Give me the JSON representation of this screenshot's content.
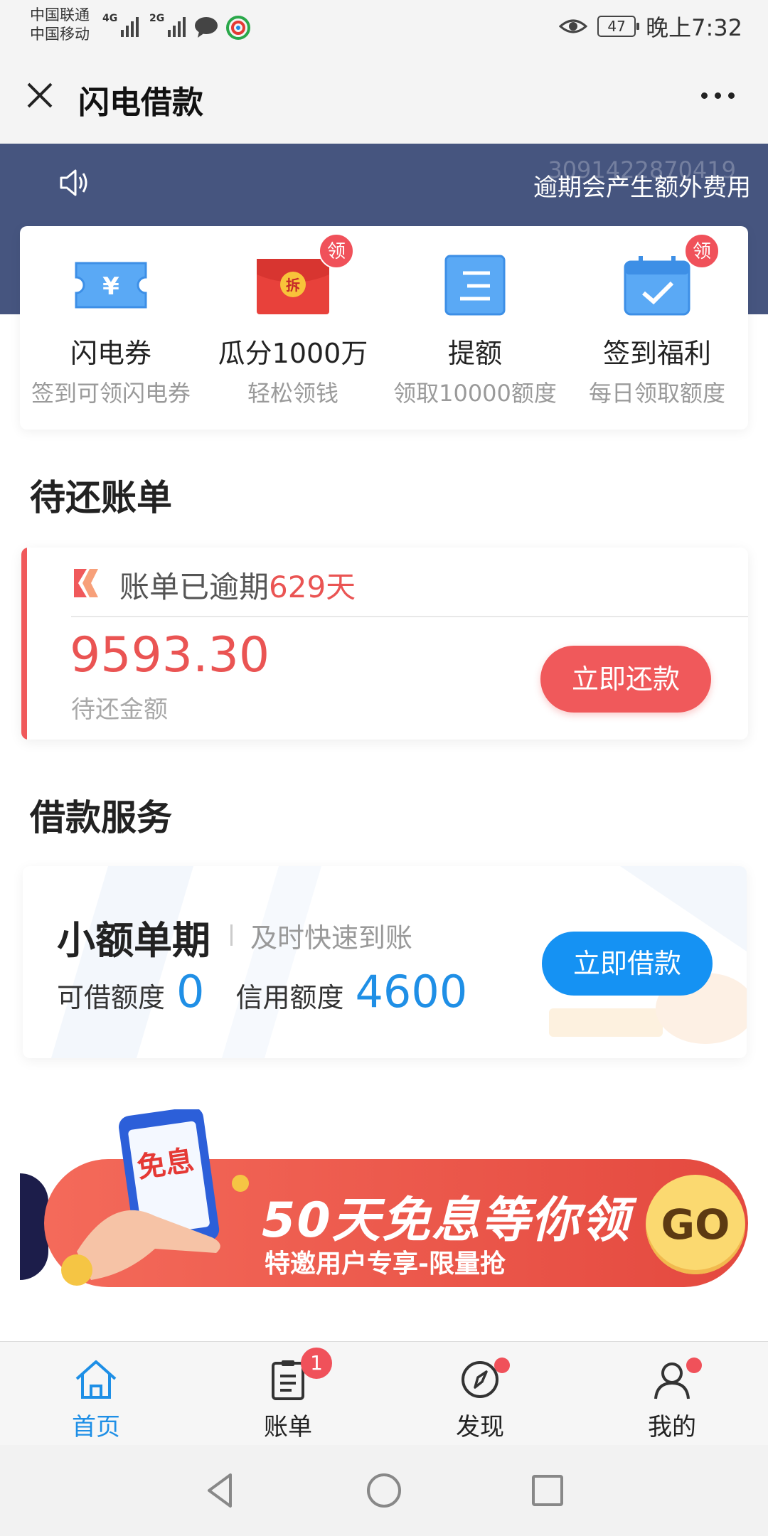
{
  "status_bar": {
    "carrier1": "中国联通",
    "carrier2": "中国移动",
    "net1": "4G",
    "net2": "2G",
    "battery": "47",
    "time": "晚上7:32"
  },
  "title_bar": {
    "title": "闪电借款"
  },
  "notice": {
    "faded_id": "3091422870419",
    "text": "逾期会产生额外费用"
  },
  "quick_entries": [
    {
      "title": "闪电券",
      "subtitle": "签到可领闪电券",
      "icon": "ticket-icon",
      "badge": ""
    },
    {
      "title": "瓜分1000万",
      "subtitle": "轻松领钱",
      "icon": "red-envelope-icon",
      "badge": "领",
      "icon_text": "拆"
    },
    {
      "title": "提额",
      "subtitle": "领取10000额度",
      "icon": "document-icon",
      "badge": ""
    },
    {
      "title": "签到福利",
      "subtitle": "每日领取额度",
      "icon": "calendar-check-icon",
      "badge": "领"
    }
  ],
  "pending_bills": {
    "section_title": "待还账单",
    "status_prefix": "账单已逾期",
    "overdue_days": "629天",
    "amount": "9593.30",
    "amount_label": "待还金额",
    "repay_button": "立即还款"
  },
  "loan_service": {
    "section_title": "借款服务",
    "product_name": "小额单期",
    "product_tag": "及时快速到账",
    "available_label": "可借额度",
    "available_value": "0",
    "credit_label": "信用额度",
    "credit_value": "4600",
    "borrow_button": "立即借款"
  },
  "banner": {
    "phone_text": "免息",
    "headline": "50天免息等你领",
    "subline": "特邀用户专享-限量抢",
    "go": "GO"
  },
  "tab_bar": [
    {
      "label": "首页",
      "icon": "home-icon",
      "active": true
    },
    {
      "label": "账单",
      "icon": "bill-icon",
      "badge": "1"
    },
    {
      "label": "发现",
      "icon": "compass-icon",
      "dot": true
    },
    {
      "label": "我的",
      "icon": "user-icon",
      "dot": true
    }
  ],
  "colors": {
    "header_band": "#46557f",
    "accent_red": "#ea5453",
    "accent_blue": "#1592f3"
  }
}
